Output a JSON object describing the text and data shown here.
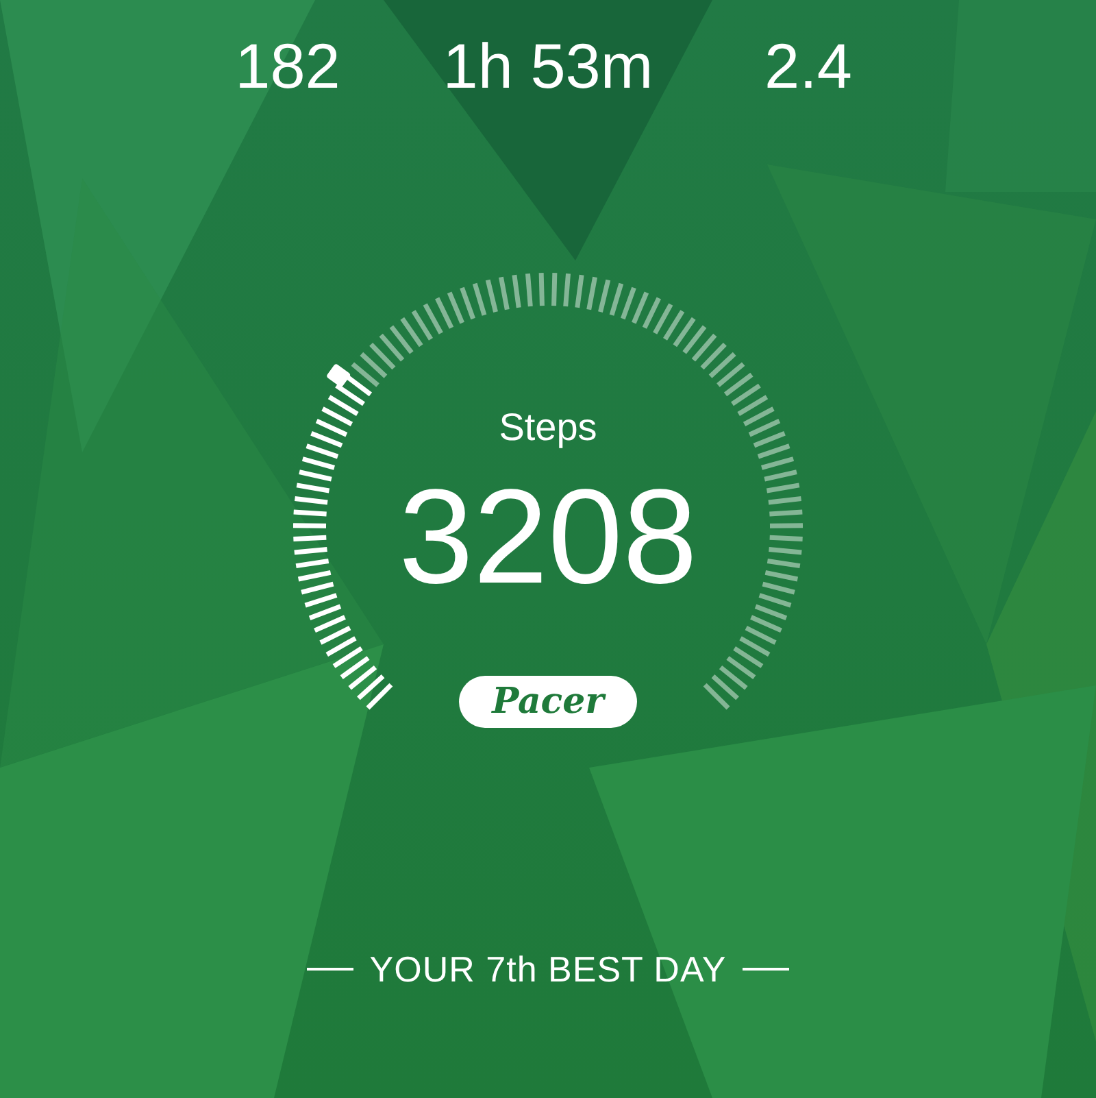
{
  "stats": [
    {
      "value": "182"
    },
    {
      "value": "1h 53m"
    },
    {
      "value": "2.4"
    }
  ],
  "steps": {
    "label": "Steps",
    "value": "3208"
  },
  "badge": {
    "text": "Pacer"
  },
  "footer": {
    "text": "YOUR 7th BEST DAY"
  }
}
